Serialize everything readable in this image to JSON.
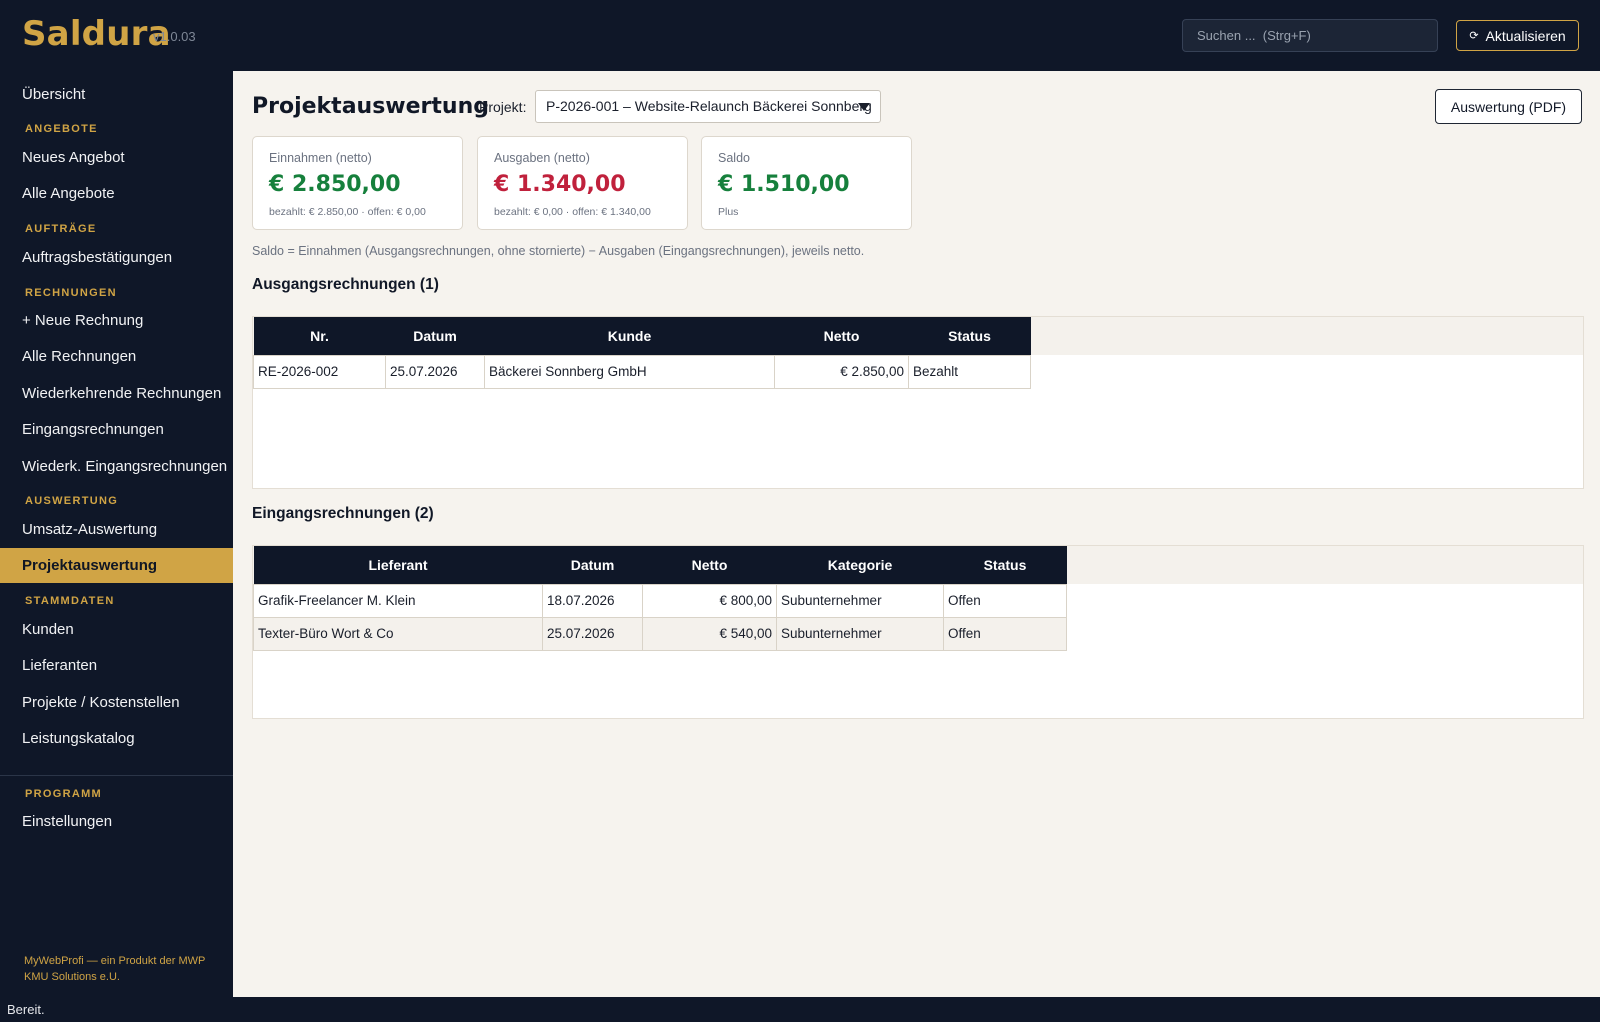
{
  "app": {
    "name": "Saldura",
    "version": "v1.0.03"
  },
  "header": {
    "search_placeholder": "Suchen ...  (Strg+F)",
    "refresh_label": "Aktualisieren",
    "refresh_icon": "refresh-icon"
  },
  "sidebar": {
    "items": {
      "uebersicht": "Übersicht",
      "neues_angebot": "Neues Angebot",
      "alle_angebote": "Alle Angebote",
      "auftragsbestaetigungen": "Auftragsbestätigungen",
      "neue_rechnung": "+ Neue Rechnung",
      "alle_rechnungen": "Alle Rechnungen",
      "wiederkehrende_rechnungen": "Wiederkehrende Rechnungen",
      "eingangsrechnungen": "Eingangsrechnungen",
      "wiederk_eingangsrechnungen": "Wiederk. Eingangsrechnungen",
      "umsatz_auswertung": "Umsatz-Auswertung",
      "projektauswertung": "Projektauswertung",
      "kunden": "Kunden",
      "lieferanten": "Lieferanten",
      "projekte_kostenstellen": "Projekte / Kostenstellen",
      "leistungskatalog": "Leistungskatalog",
      "einstellungen": "Einstellungen"
    },
    "sections": {
      "angebote": "ANGEBOTE",
      "auftraege": "AUFTRÄGE",
      "rechnungen": "RECHNUNGEN",
      "auswertung": "AUSWERTUNG",
      "stammdaten": "STAMMDATEN",
      "programm": "PROGRAMM"
    },
    "active": "Projektauswertung",
    "footer": "MyWebProfi — ein Produkt der MWP KMU Solutions e.U."
  },
  "main": {
    "title": "Projektauswertung",
    "project_label": "Projekt:",
    "project_selected": "P-2026-001 – Website-Relaunch Bäckerei Sonnberg",
    "pdf_button": "Auswertung (PDF)",
    "cards": {
      "income": {
        "label": "Einnahmen (netto)",
        "value": "€ 2.850,00",
        "sub": "bezahlt: € 2.850,00  ·  offen: € 0,00"
      },
      "expenses": {
        "label": "Ausgaben (netto)",
        "value": "€ 1.340,00",
        "sub": "bezahlt: € 0,00  ·  offen: € 1.340,00"
      },
      "balance": {
        "label": "Saldo",
        "value": "€ 1.510,00",
        "sub": "Plus"
      }
    },
    "note": "Saldo = Einnahmen (Ausgangsrechnungen, ohne stornierte) − Ausgaben (Eingangsrechnungen), jeweils netto.",
    "outgoing": {
      "title": "Ausgangsrechnungen (1)",
      "columns": {
        "nr": "Nr.",
        "datum": "Datum",
        "kunde": "Kunde",
        "netto": "Netto",
        "status": "Status"
      },
      "rows": [
        {
          "nr": "RE-2026-002",
          "datum": "25.07.2026",
          "kunde": "Bäckerei Sonnberg GmbH",
          "netto": "€ 2.850,00",
          "status": "Bezahlt"
        }
      ]
    },
    "incoming": {
      "title": "Eingangsrechnungen (2)",
      "columns": {
        "lieferant": "Lieferant",
        "datum": "Datum",
        "netto": "Netto",
        "kategorie": "Kategorie",
        "status": "Status"
      },
      "rows": [
        {
          "lieferant": "Grafik-Freelancer M. Klein",
          "datum": "18.07.2026",
          "netto": "€ 800,00",
          "kategorie": "Subunternehmer",
          "status": "Offen"
        },
        {
          "lieferant": "Texter-Büro Wort & Co",
          "datum": "25.07.2026",
          "netto": "€ 540,00",
          "kategorie": "Subunternehmer",
          "status": "Offen"
        }
      ]
    }
  },
  "statusbar": {
    "text": "Bereit."
  },
  "colors": {
    "accent": "#d0a445",
    "navy": "#0f1728",
    "positive": "#16803c",
    "negative": "#c0213c",
    "content_bg": "#f6f3ee"
  }
}
